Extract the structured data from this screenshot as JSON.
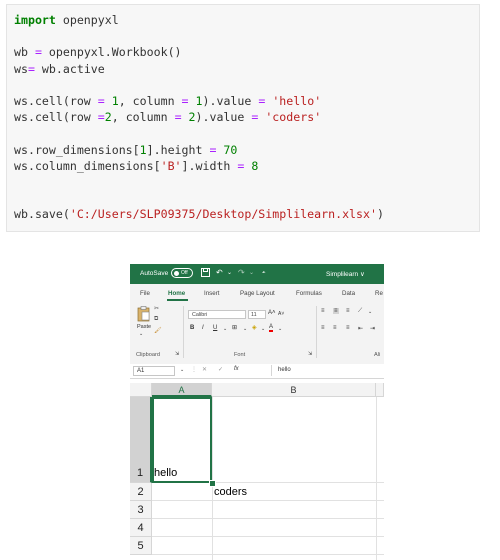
{
  "code": {
    "line1": {
      "kw": "import",
      "rest": " openpyxl"
    },
    "line2": {
      "a": "wb ",
      "op": "=",
      "b": " openpyxl.Workbook()"
    },
    "line3": {
      "a": "ws",
      "op": "=",
      "b": " wb.active"
    },
    "line4": {
      "a": "ws.cell(row ",
      "op1": "=",
      "b": " ",
      "n1": "1",
      "c": ", column ",
      "op2": "=",
      "d": " ",
      "n2": "1",
      "e": ").value ",
      "op3": "=",
      "f": " ",
      "s": "'hello'"
    },
    "line5": {
      "a": "ws.cell(row ",
      "op1": "=",
      "n1": "2",
      "c": ", column ",
      "op2": "=",
      "d": " ",
      "n2": "2",
      "e": ").value ",
      "op3": "=",
      "f": " ",
      "s": "'coders'"
    },
    "line6": {
      "a": "ws.row_dimensions[",
      "n1": "1",
      "b": "].height ",
      "op": "=",
      "c": " ",
      "n2": "70"
    },
    "line7": {
      "a": "ws.column_dimensions[",
      "s": "'B'",
      "b": "].width ",
      "op": "=",
      "c": " ",
      "n": "8"
    },
    "line8": {
      "a": "wb.save(",
      "s": "'C:/Users/SLP09375/Desktop/Simplilearn.xlsx'",
      "b": ")"
    }
  },
  "excel": {
    "autosave_label": "AutoSave",
    "autosave_state": "Off",
    "workbook_name": "Simplilearn ∨",
    "tabs": [
      "File",
      "Home",
      "Insert",
      "Page Layout",
      "Formulas",
      "Data",
      "Re"
    ],
    "active_tab": "Home",
    "font_name": "Calibri",
    "font_size": "11",
    "paste_label": "Paste",
    "groups": {
      "clipboard": "Clipboard",
      "font": "Font",
      "alignment": "Ali"
    },
    "name_box": "A1",
    "formula_value": "hello",
    "fx_label": "fx",
    "columns": [
      "A",
      "B"
    ],
    "rows": [
      "1",
      "2",
      "3",
      "4",
      "5"
    ],
    "cells": {
      "A1": "hello",
      "B2": "coders"
    }
  },
  "colors": {
    "excel_green": "#217346",
    "keyword": "#008000",
    "string": "#ba2121",
    "operator": "#aa22ff"
  }
}
